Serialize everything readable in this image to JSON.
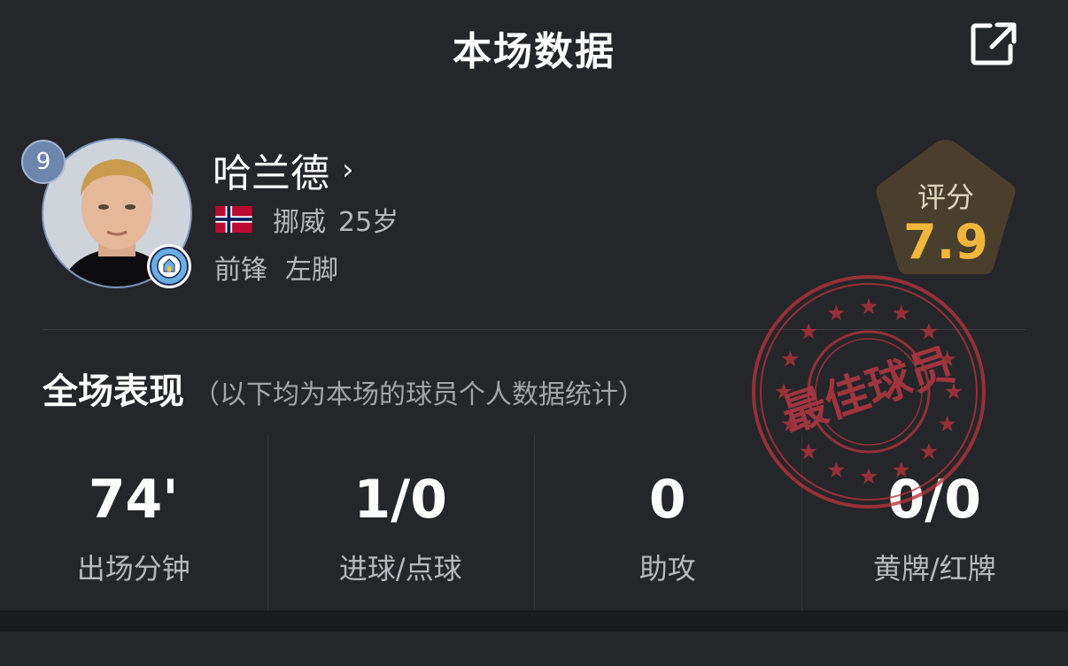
{
  "header": {
    "title": "本场数据"
  },
  "player": {
    "number": "9",
    "name": "哈兰德",
    "nation": "挪威",
    "age": "25岁",
    "position": "前锋",
    "foot": "左脚"
  },
  "rating": {
    "label": "评分",
    "value": "7.9"
  },
  "section": {
    "title": "全场表现",
    "note": "（以下均为本场的球员个人数据统计）"
  },
  "stats": [
    {
      "value": "74'",
      "label": "出场分钟"
    },
    {
      "value": "1/0",
      "label": "进球/点球"
    },
    {
      "value": "0",
      "label": "助攻"
    },
    {
      "value": "0/0",
      "label": "黄牌/红牌"
    }
  ],
  "stamp": {
    "text": "最佳球员",
    "color": "#b5343c"
  },
  "colors": {
    "background": "#25262a",
    "rating_value": "#f1b73c",
    "badge": "#6d86ad"
  },
  "icons": {
    "share": "share-external-icon",
    "chevron": "chevron-right-icon",
    "flag": "norway-flag-icon",
    "club": "manchester-city-badge-icon"
  }
}
